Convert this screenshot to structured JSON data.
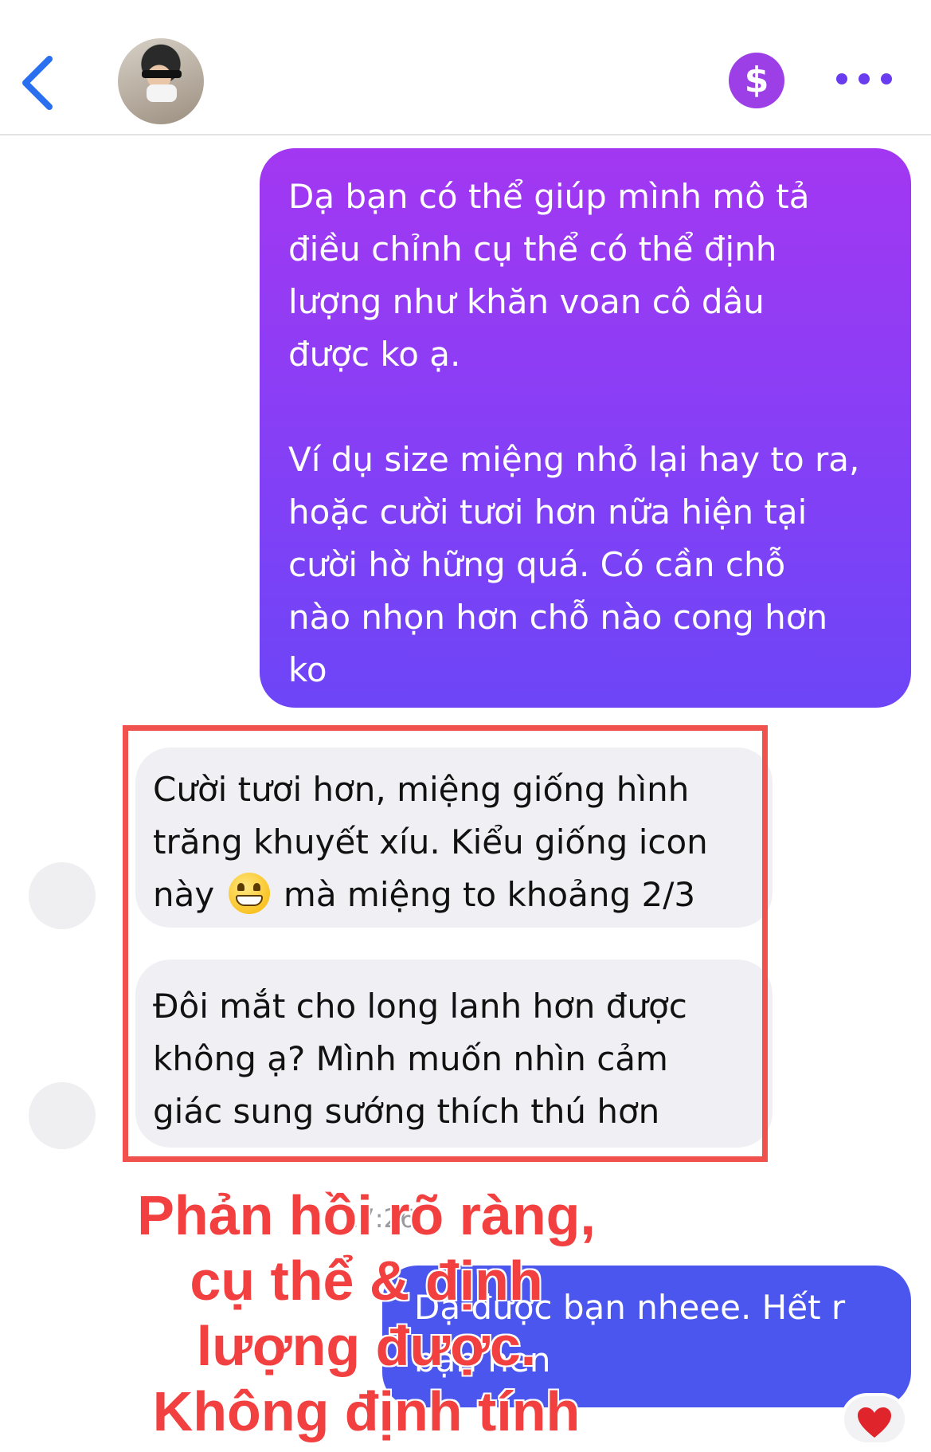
{
  "header": {
    "back_icon": "chevron-left-icon",
    "avatar_icon": "contact-avatar",
    "payment_icon": "dollar-icon",
    "more_icon": "more-horizontal-icon",
    "accent": "#9d3fe6"
  },
  "messages": [
    {
      "direction": "outgoing",
      "paragraphs": [
        "Dạ bạn có thể giúp mình mô tả\nđiều chỉnh cụ thể có thể định\nlượng như khăn voan cô dâu\nđược ko ạ.",
        "Ví dụ size miệng nhỏ lại hay to ra,\nhoặc cười tươi hơn nữa hiện tại\ncười hờ hững quá. Có cần chỗ\nnào nhọn hơn chỗ nào cong hơn\nko"
      ]
    },
    {
      "direction": "incoming",
      "text_before_emoji": "Cười tươi hơn, miệng giống hình\ntrăng khuyết xíu. Kiểu giống icon\nnày ",
      "emoji": "grinning-face-icon",
      "text_after_emoji": " mà miệng to khoảng 2/3"
    },
    {
      "direction": "incoming",
      "text": "Đôi mắt cho long lanh hơn được\nkhông ạ? Mình muốn nhìn cảm\ngiác sung sướng thích thú hơn"
    },
    {
      "direction": "outgoing",
      "text": "Dạ được bạn nheee. Hết r\nbạn nen"
    }
  ],
  "timestamp": "17:26",
  "reaction": "heart-icon",
  "overlay_caption": "Phản hồi rõ ràng,\ncụ thể & định\nlượng được.\nKhông định tính",
  "colors": {
    "outgoing_gradient_top": "#a337f2",
    "outgoing_gradient_bottom": "#6d45f7",
    "outgoing_blue": "#4b56ee",
    "incoming_bg": "#f0f0f4",
    "highlight_border": "#f0514d",
    "caption_red": "#f23f3f"
  }
}
